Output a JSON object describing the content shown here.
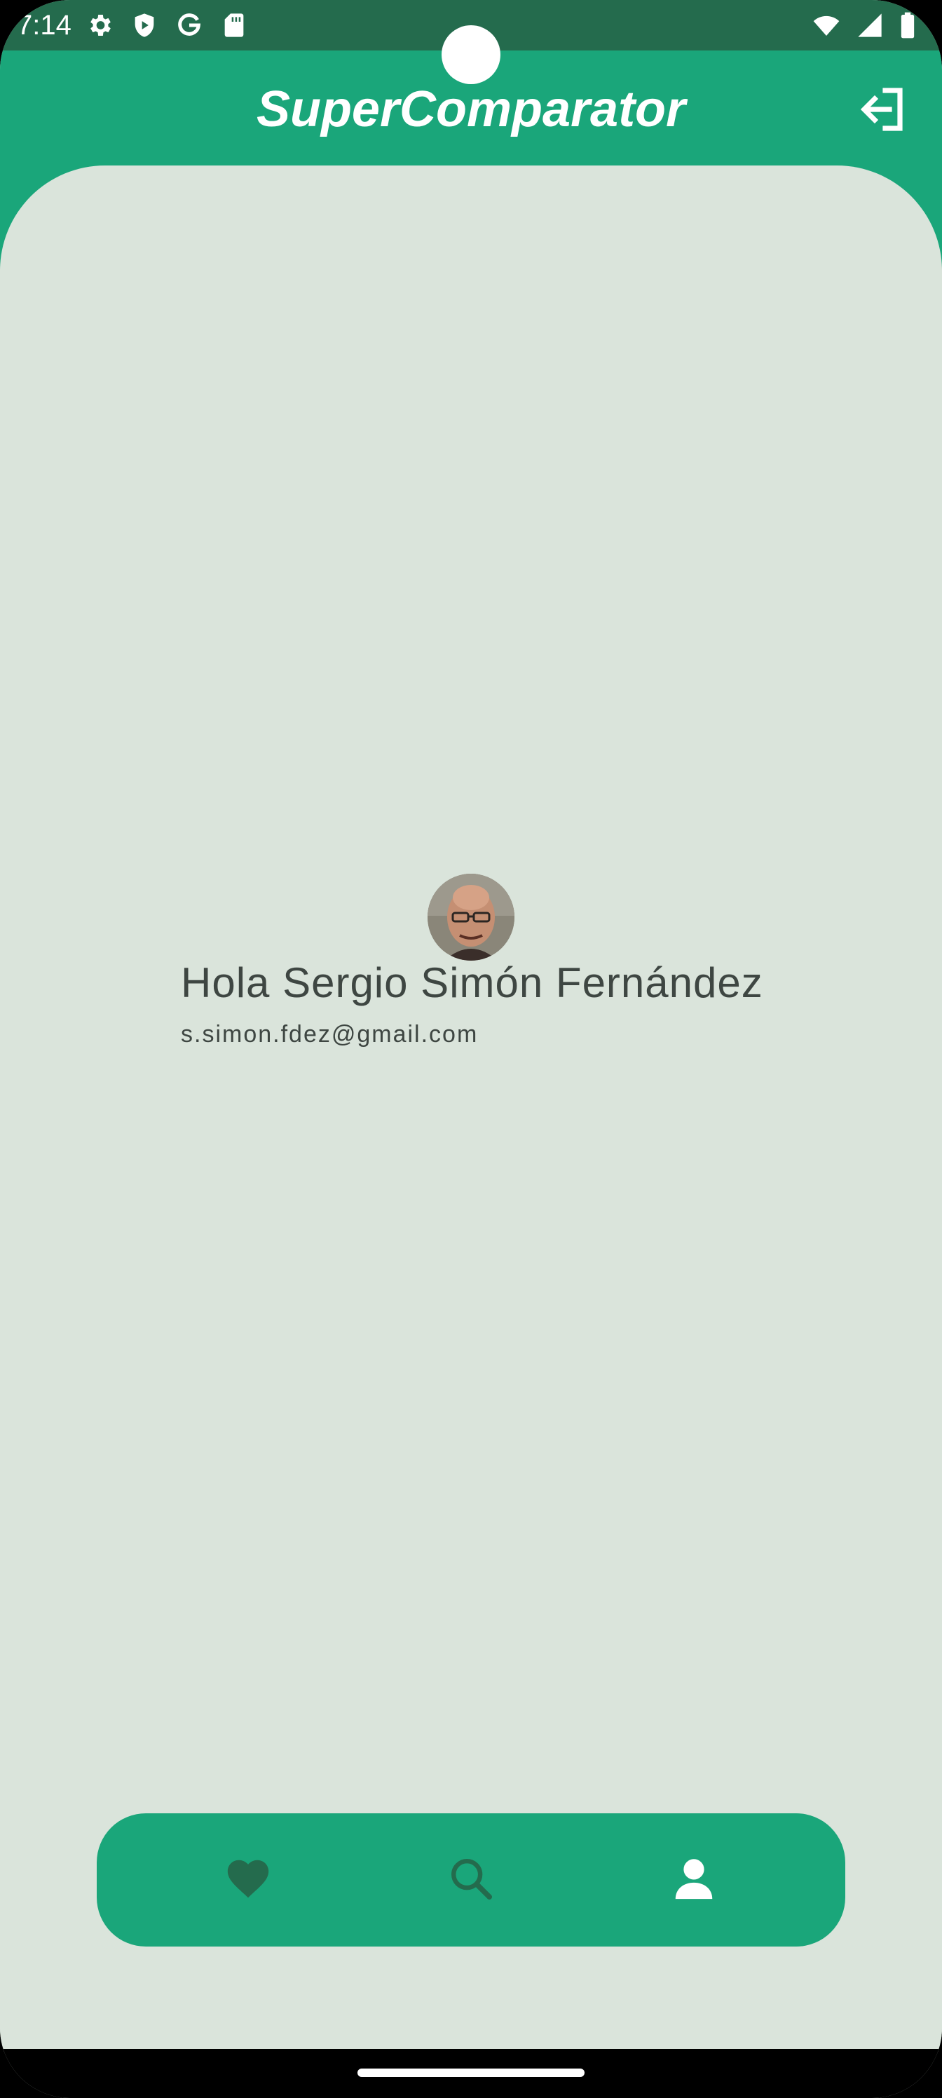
{
  "status_bar": {
    "time": "7:14",
    "left_icons": [
      "settings-icon",
      "play-protect-icon",
      "google-icon",
      "sd-card-icon"
    ],
    "right_icons": [
      "wifi-icon",
      "signal-icon",
      "battery-icon"
    ]
  },
  "app_bar": {
    "title": "SuperComparator",
    "logout_icon": "logout-icon"
  },
  "profile": {
    "avatar_icon": "avatar",
    "greeting": "Hola Sergio Simón Fernández",
    "email": "s.simon.fdez@gmail.com"
  },
  "bottom_nav": {
    "items": [
      {
        "icon": "heart-icon",
        "active": false
      },
      {
        "icon": "search-icon",
        "active": false
      },
      {
        "icon": "person-icon",
        "active": true
      }
    ]
  },
  "colors": {
    "status_bar": "#246b4d",
    "primary": "#1aa67a",
    "background": "#dae4db",
    "text": "#3e4642",
    "nav_inactive": "#246b4d",
    "nav_active": "#ffffff"
  }
}
